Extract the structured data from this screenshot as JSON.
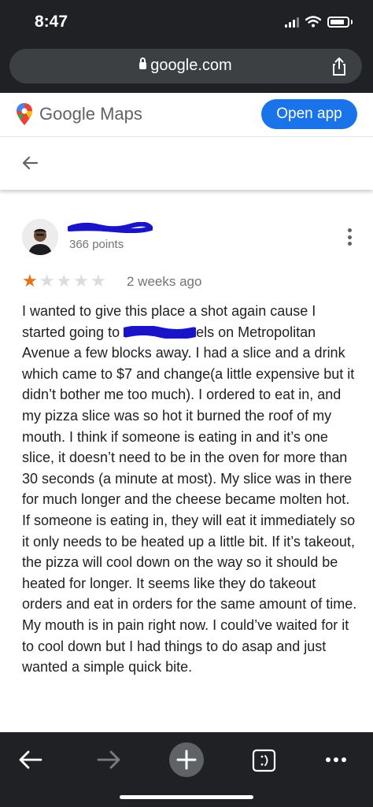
{
  "status_bar": {
    "time": "8:47"
  },
  "browser": {
    "url": "google.com"
  },
  "maps_header": {
    "brand_google": "Google",
    "brand_maps": "Maps",
    "open_app_label": "Open app"
  },
  "review": {
    "points": "366 points",
    "rating": 1,
    "max_rating": 5,
    "time_ago": "2 weeks ago",
    "text_part1": "I wanted to give this place a shot again cause I started going to ",
    "text_part2": "els on Metropolitan Avenue a few blocks away. I had a slice and a drink which came to $7 and change(a little expensive but it didn’t bother me too much). I ordered to eat in, and my pizza slice was so hot it burned the roof of my mouth. I think if someone is eating in and it’s one slice, it doesn’t need to be in the oven for more than 30 seconds (a minute at most). My slice was in there for much longer and the cheese became molten hot. If someone is eating in, they will eat it immediately so it only needs to be heated up a little bit. If it’s takeout, the pizza will cool down on the way so it should be heated for longer. It seems like they do takeout orders and eat in orders for the same amount of time. My mouth is in pain right now. I could’ve waited for it to cool down but I had things to do asap and just wanted a simple quick bite."
  },
  "colors": {
    "chrome_bg": "#202124",
    "accent_blue": "#1a73e8",
    "star_on": "#e7711b",
    "star_off": "#dadce0",
    "redaction_ink": "#1a14c8"
  }
}
